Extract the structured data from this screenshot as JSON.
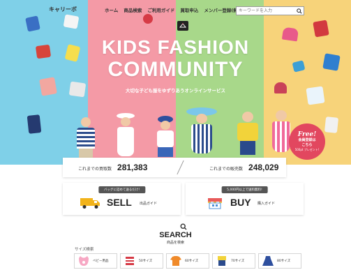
{
  "header": {
    "brand": "キャリーボ",
    "nav": [
      "ホーム",
      "商品検索",
      "ご利用ガイド",
      "買取申込",
      "メンバー登録(無料)"
    ],
    "search_placeholder": "キーワードを入力"
  },
  "hero": {
    "title_line1": "KIDS FASHION",
    "title_line2": "COMMUNITY",
    "subtitle": "大切な子ども服をゆずりあうオンラインサービス",
    "free_badge": {
      "line1": "Free!",
      "line2": "会員登録は",
      "line3": "こちら",
      "line4": "500pt プレゼント!"
    }
  },
  "stats": {
    "purchase_label": "これまでの買取数",
    "purchase_value": "281,383",
    "sales_label": "これまでの販売数",
    "sales_value": "248,029"
  },
  "cta": {
    "sell": {
      "note": "バッグに詰めて送るだけ!",
      "main": "SELL",
      "sub": "出品ガイド"
    },
    "buy": {
      "note": "5,000円以上で送料無料!",
      "main": "BUY",
      "sub": "購入ガイド"
    }
  },
  "search_section": {
    "title": "SEARCH",
    "subtitle": "商品を検索",
    "size_label": "サイズ検索",
    "sizes": [
      "ベビー用品",
      "50サイズ",
      "60サイズ",
      "70サイズ",
      "80サイズ"
    ]
  },
  "colors": {
    "stripe_blue": "#7fd0e8",
    "stripe_pink": "#f49aa6",
    "stripe_green": "#a8d88a",
    "stripe_yellow": "#f7d37a",
    "badge_red": "#e2475f"
  }
}
